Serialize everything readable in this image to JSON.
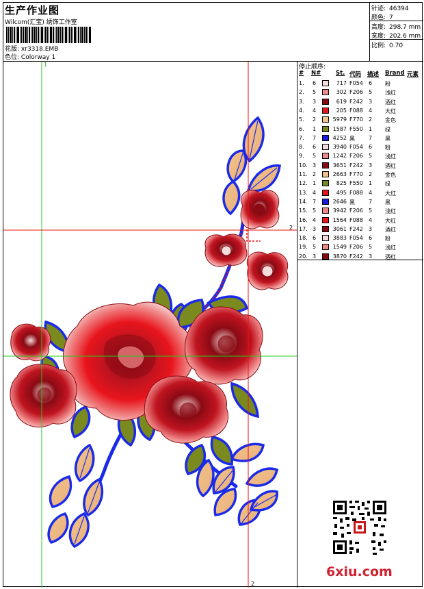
{
  "header": {
    "title": "生产作业图",
    "company": "Wilcom(汇宝) 绣饰工作室",
    "design_label": "花版:",
    "design_value": "xr3318.EMB",
    "colorway_label": "色位:",
    "colorway_value": "Colorway 1"
  },
  "stats": [
    {
      "label": "针迹:",
      "value": "46394"
    },
    {
      "label": "颜色:",
      "value": "7"
    },
    {
      "label": "高度:",
      "value": "298.7 mm"
    },
    {
      "label": "宽度:",
      "value": "202.6 mm"
    },
    {
      "label": "比例:",
      "value": "0.70"
    }
  ],
  "stop_table": {
    "title": "停止顺序:",
    "headers": {
      "num": "#",
      "n": "N#",
      "st": "St.",
      "code": "代码",
      "desc": "描述",
      "brand": "Brand",
      "element": "元素"
    },
    "rows": [
      {
        "i": "1.",
        "n": "6",
        "st": "717",
        "code": "F054",
        "desc": "6",
        "brand": "粉",
        "color": "#f4dcdc"
      },
      {
        "i": "2.",
        "n": "5",
        "st": "302",
        "code": "F206",
        "desc": "5",
        "brand": "浅红",
        "color": "#f08a8a"
      },
      {
        "i": "3.",
        "n": "3",
        "st": "619",
        "code": "F242",
        "desc": "3",
        "brand": "酒红",
        "color": "#8a0a14"
      },
      {
        "i": "4.",
        "n": "4",
        "st": "205",
        "code": "F088",
        "desc": "4",
        "brand": "大红",
        "color": "#e8141c"
      },
      {
        "i": "5.",
        "n": "2",
        "st": "5979",
        "code": "F770",
        "desc": "2",
        "brand": "金色",
        "color": "#f2c28c"
      },
      {
        "i": "6.",
        "n": "1",
        "st": "1587",
        "code": "F550",
        "desc": "1",
        "brand": "绿",
        "color": "#7a8a1e"
      },
      {
        "i": "7.",
        "n": "7",
        "st": "4252",
        "code": "黑",
        "desc": "7",
        "brand": "黑",
        "color": "#1a1ae0"
      },
      {
        "i": "8.",
        "n": "6",
        "st": "3940",
        "code": "F054",
        "desc": "6",
        "brand": "粉",
        "color": "#f4dcdc"
      },
      {
        "i": "9.",
        "n": "5",
        "st": "1242",
        "code": "F206",
        "desc": "5",
        "brand": "浅红",
        "color": "#f08a8a"
      },
      {
        "i": "10.",
        "n": "3",
        "st": "3651",
        "code": "F242",
        "desc": "3",
        "brand": "酒红",
        "color": "#8a0a14"
      },
      {
        "i": "11.",
        "n": "2",
        "st": "2663",
        "code": "F770",
        "desc": "2",
        "brand": "金色",
        "color": "#f2c28c"
      },
      {
        "i": "12.",
        "n": "1",
        "st": "825",
        "code": "F550",
        "desc": "1",
        "brand": "绿",
        "color": "#7a8a1e"
      },
      {
        "i": "13.",
        "n": "4",
        "st": "495",
        "code": "F088",
        "desc": "4",
        "brand": "大红",
        "color": "#e8141c"
      },
      {
        "i": "14.",
        "n": "7",
        "st": "2646",
        "code": "黑",
        "desc": "7",
        "brand": "黑",
        "color": "#1a1ae0"
      },
      {
        "i": "15.",
        "n": "5",
        "st": "3942",
        "code": "F206",
        "desc": "5",
        "brand": "浅红",
        "color": "#f08a8a"
      },
      {
        "i": "16.",
        "n": "4",
        "st": "1564",
        "code": "F088",
        "desc": "4",
        "brand": "大红",
        "color": "#e8141c"
      },
      {
        "i": "17.",
        "n": "3",
        "st": "3061",
        "code": "F242",
        "desc": "3",
        "brand": "酒红",
        "color": "#8a0a14"
      },
      {
        "i": "18.",
        "n": "6",
        "st": "3883",
        "code": "F054",
        "desc": "6",
        "brand": "粉",
        "color": "#f4dcdc"
      },
      {
        "i": "19.",
        "n": "5",
        "st": "1549",
        "code": "F206",
        "desc": "5",
        "brand": "浅红",
        "color": "#f08a8a"
      },
      {
        "i": "20.",
        "n": "3",
        "st": "3870",
        "code": "F242",
        "desc": "3",
        "brand": "酒红",
        "color": "#8a0a14"
      }
    ]
  },
  "guides": {
    "v1_label": "1",
    "h2_label": "2",
    "v2_label": "2"
  },
  "colors": {
    "guide_green": "#22cc22",
    "guide_red": "#ee1111",
    "outline_blue": "#1a2ae8",
    "leaf_fill": "#f2c28c",
    "leaf_green": "#7a8a1e",
    "rose_dark": "#8a0a14",
    "rose_red": "#e8141c",
    "rose_light": "#f08a8a",
    "rose_pink": "#f4dcdc"
  },
  "watermark": "6xiu.com"
}
